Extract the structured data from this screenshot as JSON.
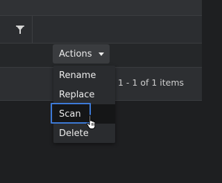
{
  "toolbar": {
    "filter_icon": "filter-funnel-icon",
    "actions_label": "Actions",
    "actions_caret_icon": "caret-down-icon"
  },
  "pager": {
    "info": "1 - 1 of 1 items"
  },
  "actions_menu": {
    "items": [
      {
        "label": "Rename"
      },
      {
        "label": "Replace"
      },
      {
        "label": "Scan"
      },
      {
        "label": "Delete"
      }
    ],
    "hovered_index": 2
  },
  "pointer": {
    "icon": "hand-pointer-cursor-icon"
  },
  "colors": {
    "background": "#1e1f21",
    "menu_background": "#2a2c2f",
    "menu_hover": "#151617",
    "focus_ring": "#3d7bd9",
    "text": "#ececec"
  }
}
